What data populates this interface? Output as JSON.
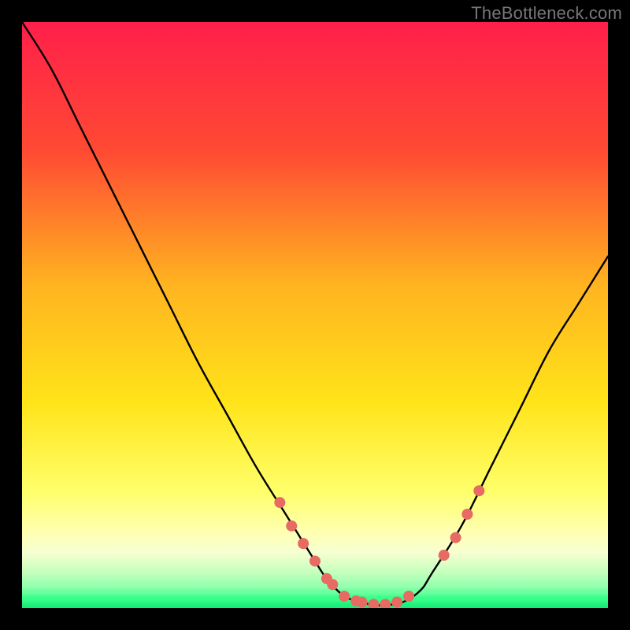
{
  "watermark": "TheBottleneck.com",
  "colors": {
    "background": "#000000",
    "gradient_top": "#ff1f4a",
    "gradient_mid1": "#ff6a2a",
    "gradient_mid2": "#ffb420",
    "gradient_mid3": "#ffe41a",
    "gradient_pale": "#ffffb0",
    "gradient_green": "#2bff84",
    "curve": "#000000",
    "marker": "#e76a63"
  },
  "chart_data": {
    "type": "line",
    "title": "",
    "xlabel": "",
    "ylabel": "",
    "xlim": [
      0,
      100
    ],
    "ylim": [
      0,
      100
    ],
    "series": [
      {
        "name": "bottleneck-curve",
        "x": [
          0,
          5,
          10,
          15,
          20,
          25,
          30,
          35,
          40,
          45,
          50,
          52,
          55,
          58,
          60,
          62,
          65,
          68,
          70,
          75,
          80,
          85,
          90,
          95,
          100
        ],
        "y": [
          100,
          92,
          82,
          72,
          62,
          52,
          42,
          33,
          24,
          16,
          8,
          5,
          2,
          1,
          0.5,
          0.5,
          1,
          3,
          6,
          14,
          24,
          34,
          44,
          52,
          60
        ]
      }
    ],
    "markers": {
      "name": "highlight-points",
      "x": [
        44,
        46,
        48,
        50,
        52,
        53,
        55,
        57,
        58,
        60,
        62,
        64,
        66,
        72,
        74,
        76,
        78
      ],
      "y": [
        18,
        14,
        11,
        8,
        5,
        4,
        2,
        1.2,
        1,
        0.6,
        0.6,
        1,
        2,
        9,
        12,
        16,
        20
      ]
    }
  }
}
